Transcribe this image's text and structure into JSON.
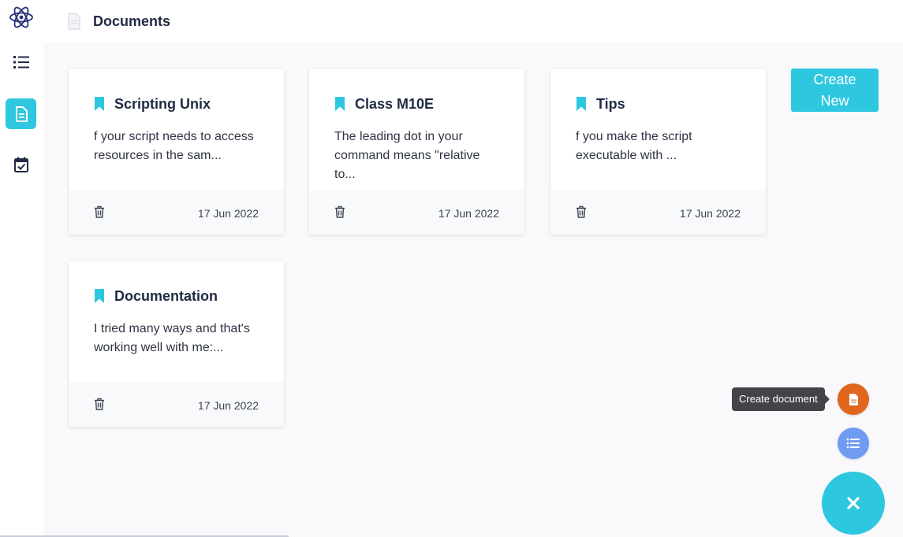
{
  "app": {
    "logo_icon": "atom-logo-icon",
    "accent_color": "#2ec7e0"
  },
  "sidebar": {
    "items": [
      {
        "name": "list",
        "icon": "list-icon",
        "active": false
      },
      {
        "name": "documents",
        "icon": "document-icon",
        "active": true
      },
      {
        "name": "calendar",
        "icon": "calendar-check-icon",
        "active": false
      }
    ]
  },
  "header": {
    "icon": "document-icon",
    "title": "Documents"
  },
  "main": {
    "create_button_label": "Create New",
    "cards": [
      {
        "title": "Scripting Unix",
        "excerpt": "f your script needs to access resources in the sam...",
        "date": "17 Jun 2022"
      },
      {
        "title": "Class M10E",
        "excerpt": "The leading dot in your command means \"relative to...",
        "date": "17 Jun 2022"
      },
      {
        "title": "Tips",
        "excerpt": "f you make the script executable with ...",
        "date": "17 Jun 2022"
      },
      {
        "title": "Documentation",
        "excerpt": "I tried many ways and that's working well with me:...",
        "date": "17 Jun 2022"
      }
    ]
  },
  "fab": {
    "tooltip": "Create document",
    "doc_color": "#e0651d",
    "list_color": "#6f9bf2",
    "main_icon": "close-icon"
  }
}
